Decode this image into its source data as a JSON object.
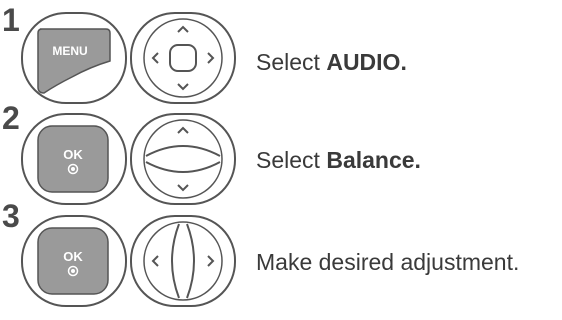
{
  "steps": [
    {
      "number": "1",
      "button1": {
        "label": "MENU",
        "icon": "menu-button-icon"
      },
      "button2": {
        "icon": "navigation-four-way-icon"
      },
      "caption_prefix": "Select ",
      "caption_bold": "AUDIO."
    },
    {
      "number": "2",
      "button1": {
        "label": "OK",
        "icon": "ok-button-icon"
      },
      "button2": {
        "icon": "navigation-up-down-icon"
      },
      "caption_prefix": "Select ",
      "caption_bold": "Balance."
    },
    {
      "number": "3",
      "button1": {
        "label": "OK",
        "icon": "ok-button-icon"
      },
      "button2": {
        "icon": "navigation-left-right-icon"
      },
      "caption_prefix": "Make desired adjustment.",
      "caption_bold": ""
    }
  ],
  "colors": {
    "button_fill": "#9a9a9a",
    "button_outline": "#555555",
    "text": "#3a3a3a"
  }
}
